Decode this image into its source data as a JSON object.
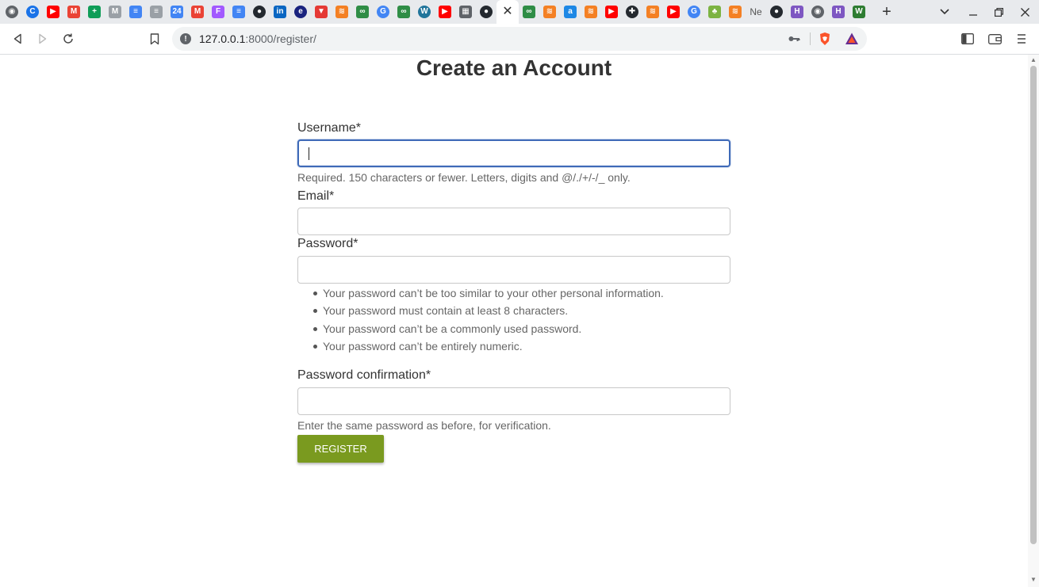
{
  "browser": {
    "tabs": [
      {
        "icon": "globe-icon",
        "color": "#5f6368",
        "glyph": "◉",
        "round": true
      },
      {
        "icon": "google-icon",
        "color": "#1a73e8",
        "glyph": "C",
        "round": true
      },
      {
        "icon": "youtube-icon",
        "color": "#ff0000",
        "glyph": "▶"
      },
      {
        "icon": "gmail-icon",
        "color": "#ea4335",
        "glyph": "M"
      },
      {
        "icon": "sheets-icon",
        "color": "#0f9d58",
        "glyph": "+"
      },
      {
        "icon": "gmail-icon",
        "color": "#9aa0a6",
        "glyph": "M"
      },
      {
        "icon": "docs-icon",
        "color": "#4285f4",
        "glyph": "≡"
      },
      {
        "icon": "docs-icon",
        "color": "#9aa0a6",
        "glyph": "≡"
      },
      {
        "icon": "calendar-icon",
        "color": "#4285f4",
        "glyph": "24"
      },
      {
        "icon": "gmail-icon",
        "color": "#ea4335",
        "glyph": "M"
      },
      {
        "icon": "figma-icon",
        "color": "#a259ff",
        "glyph": "F"
      },
      {
        "icon": "docs-icon",
        "color": "#4285f4",
        "glyph": "≡"
      },
      {
        "icon": "github-icon",
        "color": "#24292f",
        "glyph": "●",
        "round": true
      },
      {
        "icon": "linkedin-icon",
        "color": "#0a66c2",
        "glyph": "in"
      },
      {
        "icon": "blue-circle-icon",
        "color": "#1a237e",
        "glyph": "e",
        "round": true
      },
      {
        "icon": "vercel-icon",
        "color": "#e53935",
        "glyph": "▼"
      },
      {
        "icon": "stackoverflow-icon",
        "color": "#f48024",
        "glyph": "≋"
      },
      {
        "icon": "geeksforgeeks-icon",
        "color": "#2f8d46",
        "glyph": "∞"
      },
      {
        "icon": "google-icon",
        "color": "#4285f4",
        "glyph": "G",
        "round": true
      },
      {
        "icon": "geeksforgeeks-icon",
        "color": "#2f8d46",
        "glyph": "∞"
      },
      {
        "icon": "wordpress-icon",
        "color": "#21759b",
        "glyph": "W",
        "round": true
      },
      {
        "icon": "youtube-icon",
        "color": "#ff0000",
        "glyph": "▶"
      },
      {
        "icon": "book-icon",
        "color": "#5f6368",
        "glyph": "▦"
      },
      {
        "icon": "github-icon",
        "color": "#24292f",
        "glyph": "●",
        "round": true
      },
      {
        "icon": "close-icon",
        "color": "#ffffff",
        "glyph": "✕",
        "active": true
      },
      {
        "icon": "geeksforgeeks-icon",
        "color": "#2f8d46",
        "glyph": "∞"
      },
      {
        "icon": "stackoverflow-icon",
        "color": "#f48024",
        "glyph": "≋"
      },
      {
        "icon": "a-icon",
        "color": "#1e88e5",
        "glyph": "a"
      },
      {
        "icon": "stackoverflow-icon",
        "color": "#f48024",
        "glyph": "≋"
      },
      {
        "icon": "youtube-icon",
        "color": "#ff0000",
        "glyph": "▶"
      },
      {
        "icon": "plus-circle-icon",
        "color": "#24292f",
        "glyph": "✚",
        "round": true
      },
      {
        "icon": "stackoverflow-icon",
        "color": "#f48024",
        "glyph": "≋"
      },
      {
        "icon": "youtube-icon",
        "color": "#ff0000",
        "glyph": "▶"
      },
      {
        "icon": "google-icon",
        "color": "#4285f4",
        "glyph": "G",
        "round": true
      },
      {
        "icon": "tree-icon",
        "color": "#7cb342",
        "glyph": "♣"
      },
      {
        "icon": "stackoverflow-icon",
        "color": "#f48024",
        "glyph": "≋"
      },
      {
        "icon": "ne-text-icon",
        "color": "#5f6368",
        "glyph": "Ne",
        "text": true
      },
      {
        "icon": "github-icon",
        "color": "#24292f",
        "glyph": "●",
        "round": true
      },
      {
        "icon": "h-icon",
        "color": "#7e57c2",
        "glyph": "H"
      },
      {
        "icon": "globe-icon",
        "color": "#5f6368",
        "glyph": "◉",
        "round": true
      },
      {
        "icon": "h-icon",
        "color": "#7e57c2",
        "glyph": "H"
      },
      {
        "icon": "w-icon",
        "color": "#2e7d32",
        "glyph": "W"
      }
    ],
    "url_host": "127.0.0.1",
    "url_rest": ":8000/register/"
  },
  "page": {
    "title": "Create an Account",
    "username": {
      "label": "Username*",
      "value": "",
      "help": "Required. 150 characters or fewer. Letters, digits and @/./+/-/_ only."
    },
    "email": {
      "label": "Email*",
      "value": ""
    },
    "password": {
      "label": "Password*",
      "value": "",
      "rules": [
        "Your password can’t be too similar to your other personal information.",
        "Your password must contain at least 8 characters.",
        "Your password can’t be a commonly used password.",
        "Your password can’t be entirely numeric."
      ]
    },
    "password_confirmation": {
      "label": "Password confirmation*",
      "value": "",
      "help": "Enter the same password as before, for verification."
    },
    "register_label": "Register"
  },
  "colors": {
    "accent_button": "#7a9a1f",
    "focus_border": "#3f6ab8"
  }
}
